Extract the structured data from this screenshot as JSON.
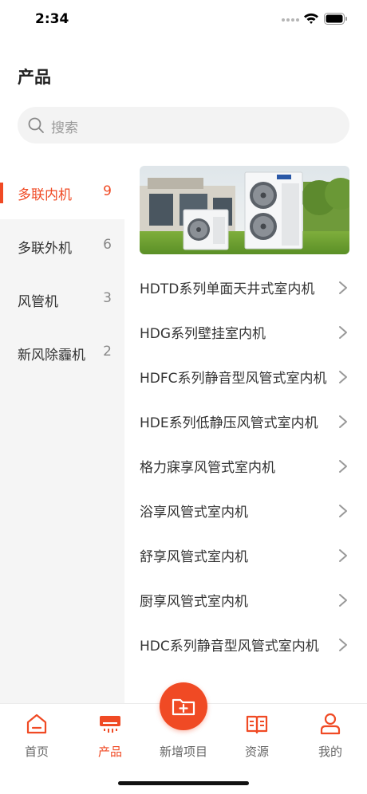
{
  "status_bar": {
    "time": "2:34"
  },
  "header": {
    "title": "产品"
  },
  "search": {
    "placeholder": "搜索"
  },
  "categories": [
    {
      "label": "多联内机",
      "count": "9",
      "active": true
    },
    {
      "label": "多联外机",
      "count": "6",
      "active": false
    },
    {
      "label": "风管机",
      "count": "3",
      "active": false
    },
    {
      "label": "新风除霾机",
      "count": "2",
      "active": false
    }
  ],
  "products": [
    {
      "label": "HDTD系列单面天井式室内机"
    },
    {
      "label": "HDG系列壁挂室内机"
    },
    {
      "label": "HDFC系列静音型风管式室内机"
    },
    {
      "label": "HDE系列低静压风管式室内机"
    },
    {
      "label": "格力寐享风管式室内机"
    },
    {
      "label": "浴享风管式室内机"
    },
    {
      "label": "舒享风管式室内机"
    },
    {
      "label": "厨享风管式室内机"
    },
    {
      "label": "HDC系列静音型风管式室内机"
    }
  ],
  "tabbar": {
    "items": [
      {
        "label": "首页",
        "icon": "home-icon"
      },
      {
        "label": "产品",
        "icon": "air-conditioner-icon",
        "active": true
      },
      {
        "label": "新增项目",
        "icon": "add-folder-icon"
      },
      {
        "label": "资源",
        "icon": "book-icon"
      },
      {
        "label": "我的",
        "icon": "user-icon"
      }
    ]
  },
  "colors": {
    "accent": "#f04a24",
    "sidebar_bg": "#f5f5f5",
    "search_bg": "#f3f3f3"
  }
}
